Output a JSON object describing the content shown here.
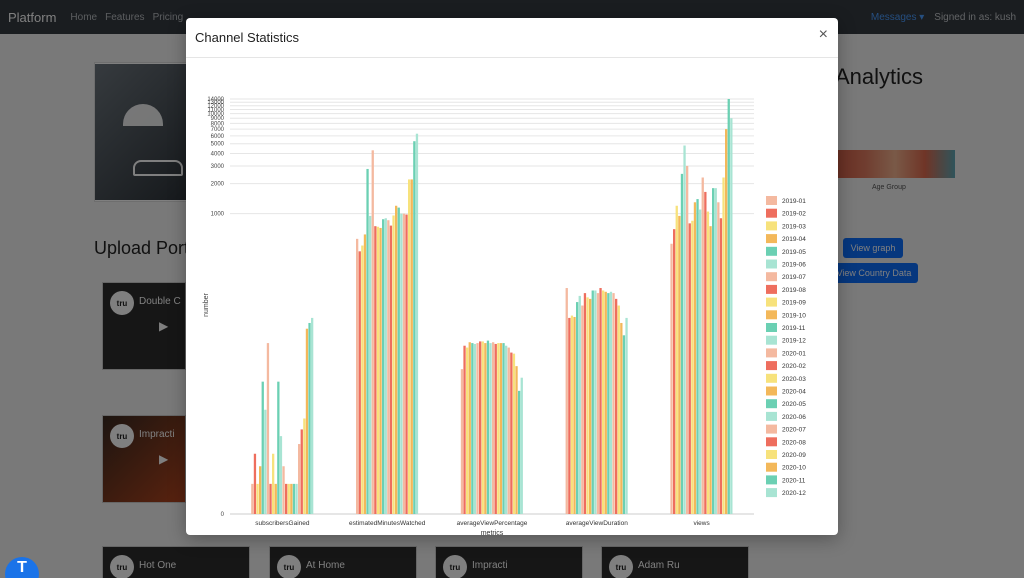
{
  "navbar": {
    "brand": "Platform",
    "links": [
      "Home",
      "Features",
      "Pricing"
    ],
    "messages": "Messages ▾",
    "signed_in": "Signed in as: kush"
  },
  "background": {
    "upload_title": "Upload Port",
    "analytics_title": "Analytics",
    "age_label": "Age Group",
    "view_graph": "View graph",
    "view_country": "View Country Data",
    "thumbs": [
      {
        "title": "Double C"
      },
      {
        "title": "Impracti"
      },
      {
        "title": "Hot One"
      },
      {
        "title": "At Home"
      },
      {
        "title": "Impracti"
      },
      {
        "title": "Adam Ru"
      }
    ],
    "thumb_logo": "tru"
  },
  "modal": {
    "title": "Channel Statistics",
    "close": "×"
  },
  "chart_data": {
    "type": "bar",
    "ylabel": "number",
    "xlabel": "metrics",
    "yscale": "log",
    "yticks": [
      "0",
      "1000",
      "2000",
      "3000",
      "4000",
      "5000",
      "6000",
      "7000",
      "8000",
      "9000",
      "10000",
      "11000",
      "12000",
      "13000",
      "14000"
    ],
    "categories": [
      "subscribersGained",
      "estimatedMinutesWatched",
      "averageViewPercentage",
      "averageViewDuration",
      "views"
    ],
    "series_names": [
      "2019-01",
      "2019-02",
      "2019-03",
      "2019-04",
      "2019-05",
      "2019-06",
      "2019-07",
      "2019-08",
      "2019-09",
      "2019-10",
      "2019-11",
      "2019-12",
      "2020-01",
      "2020-02",
      "2020-03",
      "2020-04",
      "2020-05",
      "2020-06",
      "2020-07",
      "2020-08",
      "2020-09",
      "2020-10",
      "2020-11",
      "2020-12"
    ],
    "colors": [
      "#f4b9a0",
      "#ee6e5e",
      "#f7e27c",
      "#f3b85a",
      "#6bd0b3",
      "#a8e4d3"
    ],
    "values": [
      [
        1,
        3,
        1,
        2,
        20,
        10,
        50,
        1,
        3,
        1,
        20,
        5,
        2,
        1,
        1,
        1,
        1,
        1,
        4,
        6,
        8,
        70,
        80,
        90
      ],
      [
        560,
        420,
        480,
        620,
        2800,
        950,
        4300,
        750,
        740,
        720,
        880,
        900,
        860,
        760,
        960,
        1200,
        1150,
        1000,
        1000,
        980,
        2200,
        2200,
        5300,
        6300
      ],
      [
        27,
        47,
        45,
        51,
        50,
        49,
        50,
        52,
        52,
        50,
        53,
        50,
        51,
        49,
        50,
        50,
        50,
        47,
        45,
        40,
        39,
        29,
        16,
        22
      ],
      [
        180,
        90,
        95,
        92,
        130,
        150,
        120,
        160,
        145,
        140,
        170,
        170,
        160,
        180,
        170,
        165,
        160,
        165,
        160,
        140,
        120,
        80,
        60,
        90
      ],
      [
        500,
        700,
        1200,
        950,
        2500,
        4800,
        3000,
        800,
        850,
        1300,
        1400,
        1100,
        2300,
        1650,
        1050,
        750,
        1800,
        1800,
        1300,
        900,
        2300,
        7000,
        14000,
        9000
      ]
    ]
  },
  "fab": "T"
}
